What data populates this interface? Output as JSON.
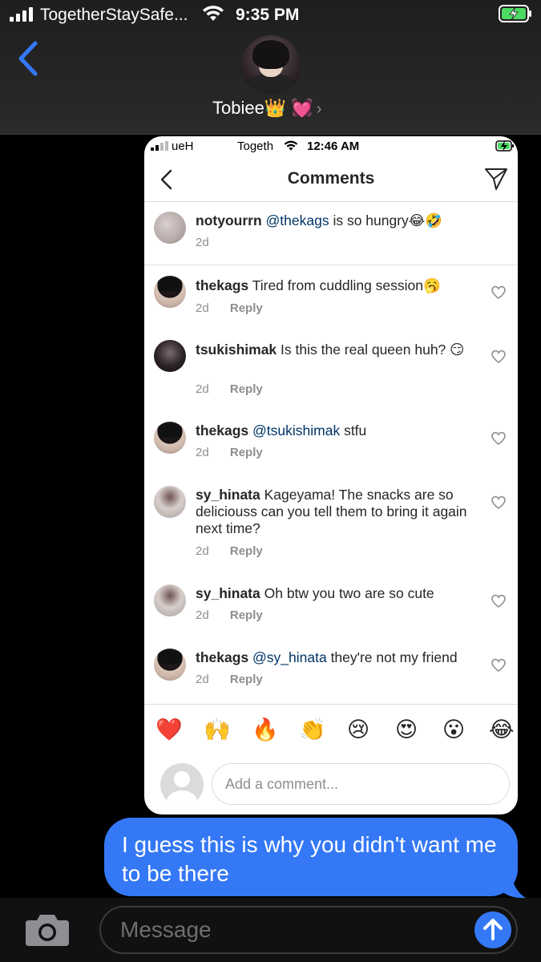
{
  "status_bar": {
    "carrier": "TogetherStaySafe...",
    "time": "9:35 PM"
  },
  "conversation": {
    "contact_name": "Tobiee👑 💓",
    "back_icon": "chevron-left-icon"
  },
  "embedded_screenshot": {
    "status_bar": {
      "carrier": "ueH",
      "carrier2": "Togeth",
      "time": "12:46 AM"
    },
    "title": "Comments",
    "comments": [
      {
        "user": "notyourrn",
        "mention": "@thekags",
        "text": " is so hungry😂🤣",
        "time": "2d",
        "reply": ""
      },
      {
        "user": "thekags",
        "mention": "",
        "text": "Tired from cuddling session🥱",
        "time": "2d",
        "reply": "Reply"
      },
      {
        "user": "tsukishimak",
        "mention": "",
        "text": "Is this the real queen huh? 😏",
        "time": "2d",
        "reply": "Reply"
      },
      {
        "user": "thekags",
        "mention": "@tsukishimak",
        "text": " stfu",
        "time": "2d",
        "reply": "Reply"
      },
      {
        "user": "sy_hinata",
        "mention": "",
        "text": "Kageyama! The snacks are so deliciouss can you tell them to bring it again next time?",
        "time": "2d",
        "reply": "Reply"
      },
      {
        "user": "sy_hinata",
        "mention": "",
        "text": "Oh btw you two are so cute",
        "time": "2d",
        "reply": "Reply"
      },
      {
        "user": "thekags",
        "mention": "@sy_hinata",
        "text": " they're not my friend",
        "time": "2d",
        "reply": "Reply"
      }
    ],
    "quick_emojis": [
      "❤️",
      "🙌",
      "🔥",
      "👏",
      "😢",
      "😍",
      "😮",
      "😂"
    ],
    "comment_placeholder": "Add a comment..."
  },
  "message": {
    "text": "I guess this is why you didn't want me to be there",
    "color": "#3478f6"
  },
  "input_bar": {
    "placeholder": "Message",
    "camera_icon": "camera-icon",
    "send_icon": "arrow-up-icon"
  }
}
